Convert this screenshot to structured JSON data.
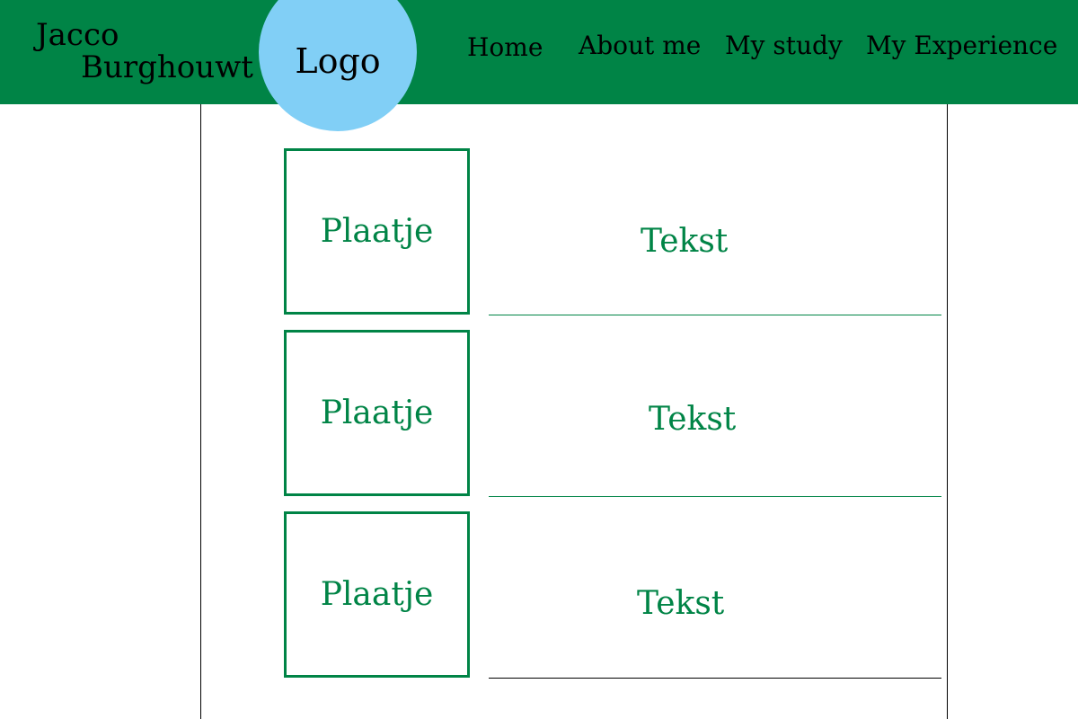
{
  "header": {
    "name_first": "Jacco",
    "name_last": "Burghouwt",
    "logo": "Logo",
    "background_color": "#008446",
    "logo_color": "#81cff6"
  },
  "nav": {
    "items": [
      {
        "label": "Home"
      },
      {
        "label": "About me"
      },
      {
        "label": "My study"
      },
      {
        "label": "My Experience"
      }
    ]
  },
  "main": {
    "rows": [
      {
        "image_label": "Plaatje",
        "text": "Tekst"
      },
      {
        "image_label": "Plaatje",
        "text": "Tekst"
      },
      {
        "image_label": "Plaatje",
        "text": "Tekst"
      }
    ],
    "accent_color": "#008446"
  }
}
